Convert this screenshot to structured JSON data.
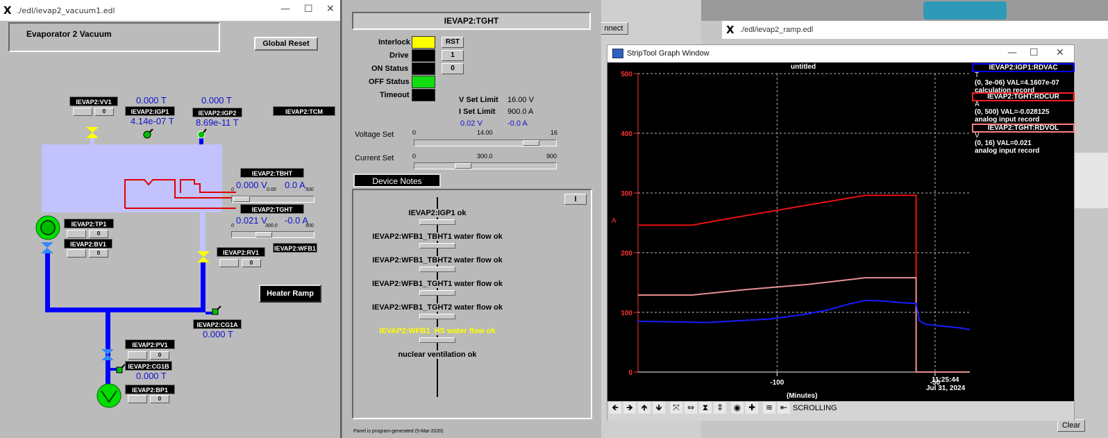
{
  "vacuum_window": {
    "title": "./edl/ievap2_vacuum1.edl",
    "header": "Evaporator 2 Vacuum",
    "global_reset": "Global Reset",
    "heater_ramp": "Heater Ramp",
    "pvs": {
      "vv1": "IEVAP2:VV1",
      "igp1": "IEVAP2:IGP1",
      "igp2": "IEVAP2:IGP2",
      "tcm": "IEVAP2:TCM",
      "tbht": "IEVAP2:TBHT",
      "tght": "IEVAP2:TGHT",
      "tp1": "IEVAP2:TP1",
      "bv1": "IEVAP2:BV1",
      "rv1": "IEVAP2:RV1",
      "wfb1": "IEVAP2:WFB1",
      "cg1a": "IEVAP2:CG1A",
      "pv1": "IEVAP2:PV1",
      "cg1b": "IEVAP2:CG1B",
      "bp1": "IEVAP2:BP1"
    },
    "readings": {
      "vv1_t": "0.000 T",
      "igp1_val": "4.14e-07 T",
      "igp2_t": "0.000 T",
      "igp2_val": "8.69e-11 T",
      "tbht_v": "0.000 V",
      "tbht_a": "0.0 A",
      "tght_v": "0.021 V",
      "tght_a": "-0.0 A",
      "cg1a_val": "0.000 T",
      "cg1b_val": "0.000 T"
    },
    "scales": {
      "tbht_min": "0",
      "tbht_mid": "0.00",
      "tbht_max": "500",
      "tght_min": "0",
      "tght_mid": "300.0",
      "tght_max": "900"
    },
    "btn_zero": "0"
  },
  "tght_window": {
    "title": "IEVAP2:TGHT",
    "interlock": "Interlock",
    "drive": "Drive",
    "on_status": "ON Status",
    "off_status": "OFF Status",
    "timeout": "Timeout",
    "rst": "RST",
    "btn1": "1",
    "btn0": "0",
    "v_set_limit_label": "V Set Limit",
    "v_set_limit_value": "16.00 V",
    "i_set_limit_label": "I Set Limit",
    "i_set_limit_value": "900.0 A",
    "v_readback": "0.02 V",
    "a_readback": "-0.0 A",
    "voltage_set": "Voltage Set",
    "voltage_min": "0",
    "voltage_mid": "14.00",
    "voltage_max": "16",
    "current_set": "Current Set",
    "current_min": "0",
    "current_mid": "300.0",
    "current_max": "900",
    "device_notes": "Device Notes",
    "notes_btn": "I",
    "notes": [
      "IEVAP2:IGP1 ok",
      "IEVAP2:WFB1_TBHT1 water flow ok",
      "IEVAP2:WFB1_TBHT2 water flow ok",
      "IEVAP2:WFB1_TGHT1 water flow ok",
      "IEVAP2:WFB1_TGHT2 water flow ok",
      "IEVAP2:WFB1_HS water flow ok",
      "nuclear ventilation ok"
    ],
    "footer": "Panel is program-generated (5-Mar-2020)",
    "colors": {
      "interlock": "#ffff00",
      "off_status": "#00cc00",
      "warning_text": "#ffff00"
    }
  },
  "background": {
    "ramp_title": "./edl/ievap2_ramp.edl",
    "connect": "nnect",
    "clear": "Clear"
  },
  "striptool": {
    "title": "StripTool Graph Window",
    "graph_title": "untitled",
    "time": "11:25:44",
    "date": "Jul 31, 2024",
    "toolbar_status": "SCROLLING",
    "legend": [
      {
        "name": "IEVAP2:IGP1:RDVAC",
        "unit": "T",
        "range": "(0, 3e-06) VAL=4.1607e-07",
        "desc": "calculation record",
        "color": "#0000ff"
      },
      {
        "name": "IEVAP2:TGHT:RDCUR",
        "unit": "A",
        "range": "(0, 500) VAL=-0.028125",
        "desc": "analog input record",
        "color": "#ff0000"
      },
      {
        "name": "IEVAP2:TGHT:RDVOL",
        "unit": "V",
        "range": "(0, 16) VAL=0.021",
        "desc": "analog input record",
        "color": "#ff8080"
      }
    ]
  },
  "chart_data": {
    "type": "line",
    "title": "untitled",
    "xlabel": "(Minutes)",
    "ylabel": "A",
    "xlim": [
      -144,
      -39
    ],
    "ylim": [
      0,
      500
    ],
    "x_ticks": [
      "-100",
      "-50"
    ],
    "y_ticks": [
      "0",
      "100",
      "200",
      "300",
      "400",
      "500"
    ],
    "grid": true,
    "series": [
      {
        "name": "IEVAP2:TGHT:RDCUR",
        "color": "#ee1111",
        "x": [
          -144,
          -127,
          -110,
          -90,
          -72,
          -56,
          -56,
          -39
        ],
        "y": [
          246,
          246,
          262,
          280,
          296,
          296,
          0,
          0
        ]
      },
      {
        "name": "IEVAP2:TGHT:RDVOL",
        "color": "#e89090",
        "x": [
          -144,
          -127,
          -110,
          -90,
          -72,
          -56,
          -56,
          -39
        ],
        "y": [
          129,
          129,
          138,
          147,
          158,
          158,
          0,
          0
        ]
      },
      {
        "name": "IEVAP2:IGP1:RDVAC",
        "color": "#1a1aff",
        "x": [
          -144,
          -132,
          -122,
          -112,
          -102,
          -92,
          -84,
          -78,
          -72,
          -66,
          -60,
          -56,
          -55,
          -53,
          -48,
          -42,
          -39
        ],
        "y": [
          85,
          84,
          83,
          86,
          89,
          96,
          104,
          113,
          120,
          119,
          116,
          115,
          86,
          80,
          77,
          74,
          71
        ]
      }
    ]
  }
}
